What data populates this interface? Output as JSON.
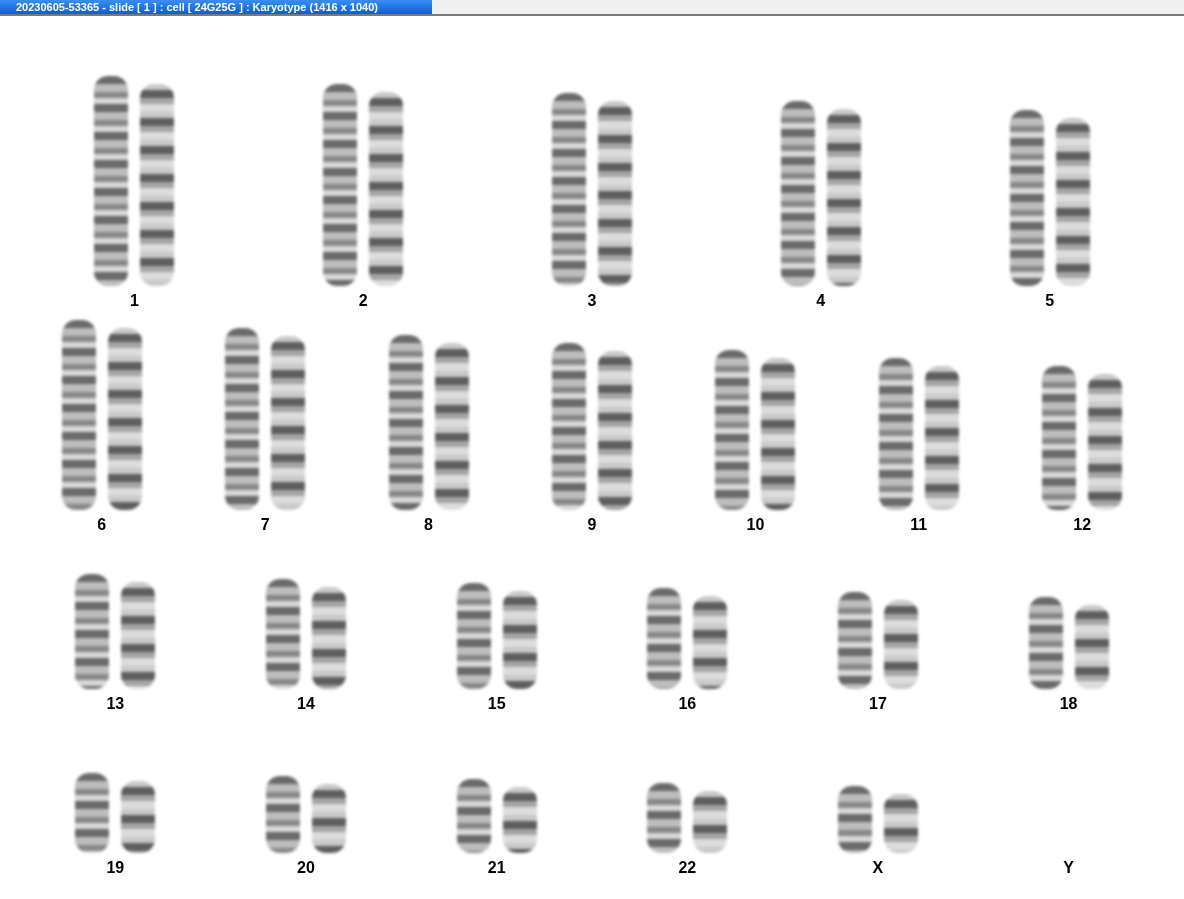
{
  "window": {
    "title": "20230605-53365 - slide [ 1 ] : cell [ 24G25G ] : Karyotype  (1416 x 1040)"
  },
  "karyotype": {
    "rows": [
      [
        {
          "label": "1",
          "empty": false
        },
        {
          "label": "2",
          "empty": false
        },
        {
          "label": "3",
          "empty": false
        },
        {
          "label": "4",
          "empty": false
        },
        {
          "label": "5",
          "empty": false
        }
      ],
      [
        {
          "label": "6",
          "empty": false
        },
        {
          "label": "7",
          "empty": false
        },
        {
          "label": "8",
          "empty": false
        },
        {
          "label": "9",
          "empty": false
        },
        {
          "label": "10",
          "empty": false
        },
        {
          "label": "11",
          "empty": false
        },
        {
          "label": "12",
          "empty": false
        }
      ],
      [
        {
          "label": "13",
          "empty": false
        },
        {
          "label": "14",
          "empty": false
        },
        {
          "label": "15",
          "empty": false
        },
        {
          "label": "16",
          "empty": false
        },
        {
          "label": "17",
          "empty": false
        },
        {
          "label": "18",
          "empty": false
        }
      ],
      [
        {
          "label": "19",
          "empty": false
        },
        {
          "label": "20",
          "empty": false
        },
        {
          "label": "21",
          "empty": false
        },
        {
          "label": "22",
          "empty": false
        },
        {
          "label": "X",
          "empty": false
        },
        {
          "label": "Y",
          "empty": true
        }
      ]
    ]
  }
}
